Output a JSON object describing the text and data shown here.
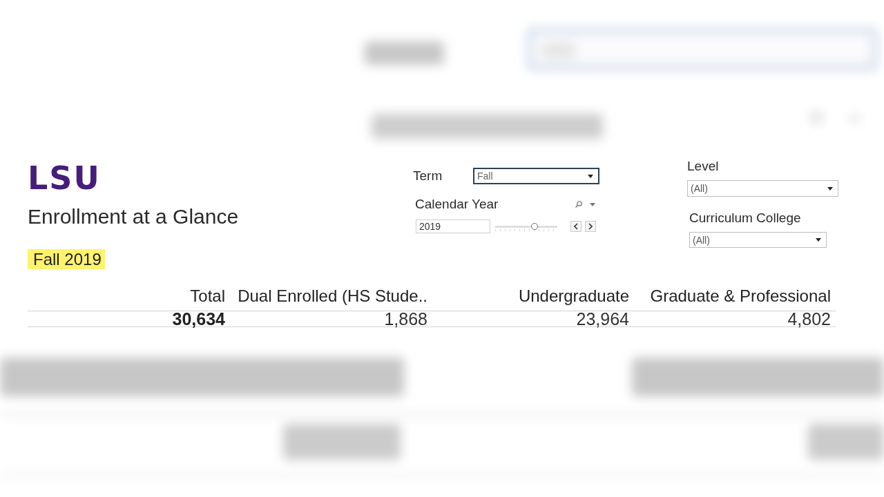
{
  "brand": {
    "logo": "LSU",
    "title": "Enrollment at a Glance",
    "period": "Fall 2019"
  },
  "filters": {
    "term": {
      "label": "Term",
      "value": "Fall",
      "focused": true
    },
    "calendar_year": {
      "label": "Calendar Year",
      "value": "2019",
      "slider": {
        "level": 0.63
      }
    },
    "level": {
      "label": "Level",
      "value": "(All)",
      "focused": false
    },
    "curriculum_college": {
      "label": "Curriculum College",
      "value": "(All)",
      "focused": false
    }
  },
  "table": {
    "columns": [
      {
        "kind": "total",
        "header": "Total",
        "value": "30,634"
      },
      {
        "kind": "breakdown",
        "header": "Dual Enrolled (HS Stude..",
        "value": "1,868"
      },
      {
        "kind": "breakdown",
        "header": "Undergraduate",
        "value": "23,964"
      },
      {
        "kind": "breakdown",
        "header": "Graduate & Professional",
        "value": "4,802"
      }
    ]
  }
}
